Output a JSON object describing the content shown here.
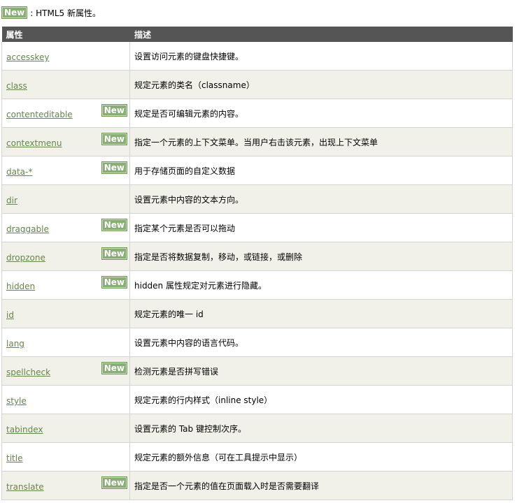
{
  "note": {
    "badge": "New",
    "text": ": HTML5 新属性。"
  },
  "table": {
    "headers": [
      "属性",
      "描述"
    ],
    "new_label": "New",
    "rows": [
      {
        "attr": "accesskey",
        "desc": "设置访问元素的键盘快捷键。",
        "is_new": false
      },
      {
        "attr": "class",
        "desc": "规定元素的类名（classname）",
        "is_new": false
      },
      {
        "attr": "contenteditable",
        "desc": "规定是否可编辑元素的内容。",
        "is_new": true
      },
      {
        "attr": "contextmenu",
        "desc": "指定一个元素的上下文菜单。当用户右击该元素，出现上下文菜单",
        "is_new": true
      },
      {
        "attr": "data-*",
        "desc": "用于存储页面的自定义数据",
        "is_new": true
      },
      {
        "attr": "dir",
        "desc": "设置元素中内容的文本方向。",
        "is_new": false
      },
      {
        "attr": "draggable",
        "desc": "指定某个元素是否可以拖动",
        "is_new": true
      },
      {
        "attr": "dropzone",
        "desc": "指定是否将数据复制，移动，或链接，或删除",
        "is_new": true
      },
      {
        "attr": "hidden",
        "desc": "hidden 属性规定对元素进行隐藏。",
        "is_new": true
      },
      {
        "attr": "id",
        "desc": "规定元素的唯一 id",
        "is_new": false
      },
      {
        "attr": "lang",
        "desc": "设置元素中内容的语言代码。",
        "is_new": false
      },
      {
        "attr": "spellcheck",
        "desc": "检测元素是否拼写错误",
        "is_new": true
      },
      {
        "attr": "style",
        "desc": "规定元素的行内样式（inline style）",
        "is_new": false
      },
      {
        "attr": "tabindex",
        "desc": "设置元素的 Tab 键控制次序。",
        "is_new": false
      },
      {
        "attr": "title",
        "desc": "规定元素的额外信息（可在工具提示中显示）",
        "is_new": false
      },
      {
        "attr": "translate",
        "desc": "指定是否一个元素的值在页面载入时是否需要翻译",
        "is_new": true
      }
    ]
  },
  "colors": {
    "header_bg": "#555555",
    "alt_row_bg": "#f1f1ea",
    "link": "#64854c",
    "badge_bg": "#8aac76"
  }
}
